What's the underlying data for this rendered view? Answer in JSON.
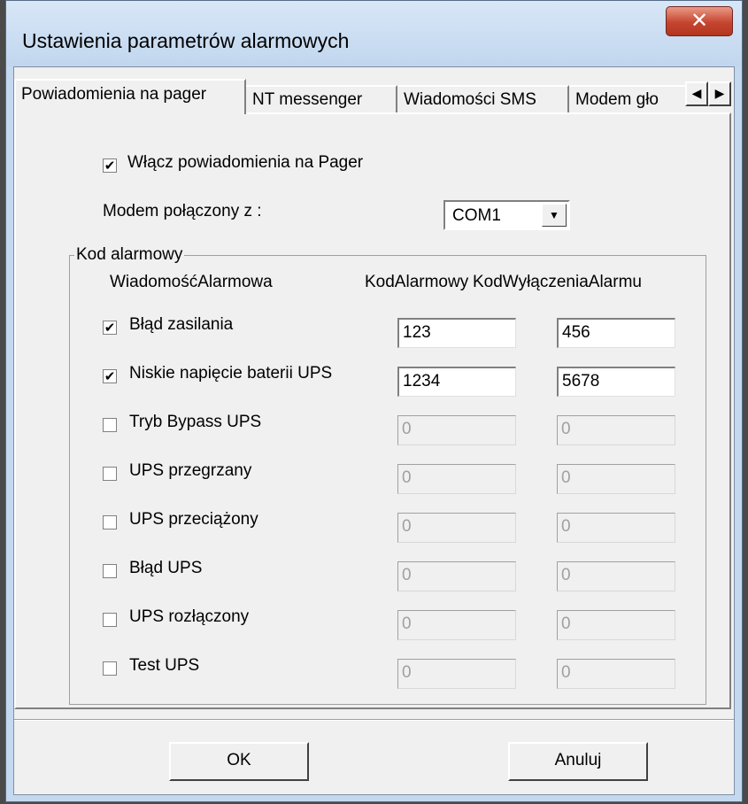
{
  "window": {
    "title": "Ustawienia parametrów alarmowych",
    "close_glyph": "✕"
  },
  "tabs": [
    {
      "label": "Powiadomienia na pager",
      "active": true
    },
    {
      "label": "NT messenger",
      "active": false
    },
    {
      "label": "Wiadomości SMS",
      "active": false
    },
    {
      "label": "Modem gło",
      "active": false
    }
  ],
  "tab_scroll": {
    "left_glyph": "◀",
    "right_glyph": "▶"
  },
  "enable_pager": {
    "label": "Włącz powiadomienia na Pager",
    "checked": true
  },
  "modem": {
    "label": "Modem połączony z :",
    "value": "COM1",
    "arrow_glyph": "▼"
  },
  "alarm_group": {
    "title": "Kod alarmowy",
    "headers": {
      "message": "WiadomośćAlarmowa",
      "code": "KodAlarmowy",
      "off_code": "KodWyłączeniaAlarmu"
    },
    "rows": [
      {
        "label": "Błąd zasilania",
        "checked": true,
        "code": "123",
        "off_code": "456"
      },
      {
        "label": "Niskie napięcie baterii UPS",
        "checked": true,
        "code": "1234",
        "off_code": "5678"
      },
      {
        "label": "Tryb Bypass UPS",
        "checked": false,
        "code": "0",
        "off_code": "0"
      },
      {
        "label": "UPS przegrzany",
        "checked": false,
        "code": "0",
        "off_code": "0"
      },
      {
        "label": "UPS przeciążony",
        "checked": false,
        "code": "0",
        "off_code": "0"
      },
      {
        "label": "Błąd UPS",
        "checked": false,
        "code": "0",
        "off_code": "0"
      },
      {
        "label": "UPS rozłączony",
        "checked": false,
        "code": "0",
        "off_code": "0"
      },
      {
        "label": "Test UPS",
        "checked": false,
        "code": "0",
        "off_code": "0"
      }
    ]
  },
  "buttons": {
    "ok": "OK",
    "cancel": "Anuluj"
  },
  "check_glyph": "✔"
}
